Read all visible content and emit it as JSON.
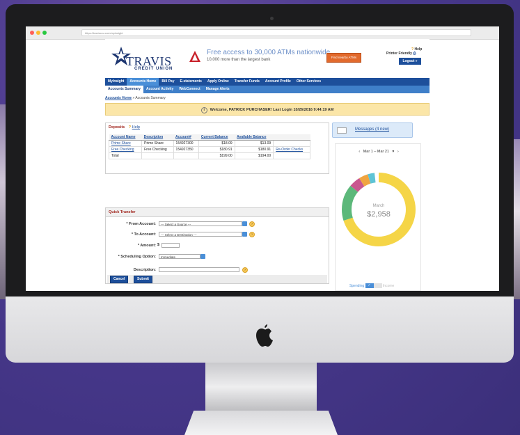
{
  "browser": {
    "url": "https://travisccu.com/myinsight"
  },
  "header": {
    "logo_name": "TRAVIS",
    "logo_sub": "CREDIT UNION",
    "promo_main": "Free access to 30,000 ATMs nationwide",
    "promo_sub": "10,000 more than the largest bank",
    "find_atm": "Find nearby ATMs",
    "help": "Help",
    "printer_friendly": "Printer Friendly",
    "logout": "Logout »"
  },
  "nav": {
    "primary": [
      "MyInsight",
      "Accounts Home",
      "Bill Pay",
      "E-statements",
      "Apply Online",
      "Transfer Funds",
      "Account Profile",
      "Other Services"
    ],
    "secondary": [
      "Accounts Summary",
      "Account Activity",
      "WebConnect",
      "Manage Alerts"
    ]
  },
  "breadcrumb": {
    "home": "Accounts Home",
    "sep": " » ",
    "current": "Accounts Summary"
  },
  "welcome": "Welcome, PATRICK PURCHASER! Last Login 10/26/2016 9:44:19 AM",
  "deposits": {
    "title": "Deposits",
    "help": "Help",
    "columns": [
      "Account Name",
      "Description",
      "Account#",
      "Current Balance",
      "Available Balance",
      ""
    ],
    "rows": [
      {
        "name": "Prime Share",
        "desc": "Prime Share",
        "acct": "154927300",
        "current": "$18.09",
        "available": "$13.09",
        "extra": ""
      },
      {
        "name": "Free Checking",
        "desc": "Free Checking",
        "acct": "154927350",
        "current": "$180.91",
        "available": "$180.91",
        "extra": "Re-Order Checks"
      }
    ],
    "total": {
      "label": "Total",
      "current": "$199.00",
      "available": "$194.00"
    }
  },
  "quick_transfer": {
    "title": "Quick Transfer",
    "from_label": "* From Account:",
    "from_value": "--- Select a Source ---",
    "to_label": "* To Account:",
    "to_value": "--- Select a Destination ---",
    "amount_label": "* Amount:",
    "amount_prefix": "$",
    "sched_label": "* Scheduling Option:",
    "sched_value": "Immediate",
    "desc_label": "Description:",
    "cancel": "Cancel",
    "submit": "Submit"
  },
  "messages": {
    "label": "Messages (4 new)"
  },
  "spending": {
    "date_range": "Mar 1 – Mar 21",
    "month": "March",
    "total": "$2,958",
    "spending_label": "Spending",
    "income_label": "Income",
    "segments": [
      {
        "color": "#f5d547",
        "value": 0.72
      },
      {
        "color": "#5cb87a",
        "value": 0.16
      },
      {
        "color": "#c9578f",
        "value": 0.05
      },
      {
        "color": "#f0a440",
        "value": 0.04
      },
      {
        "color": "#5ec4d6",
        "value": 0.03
      }
    ]
  }
}
